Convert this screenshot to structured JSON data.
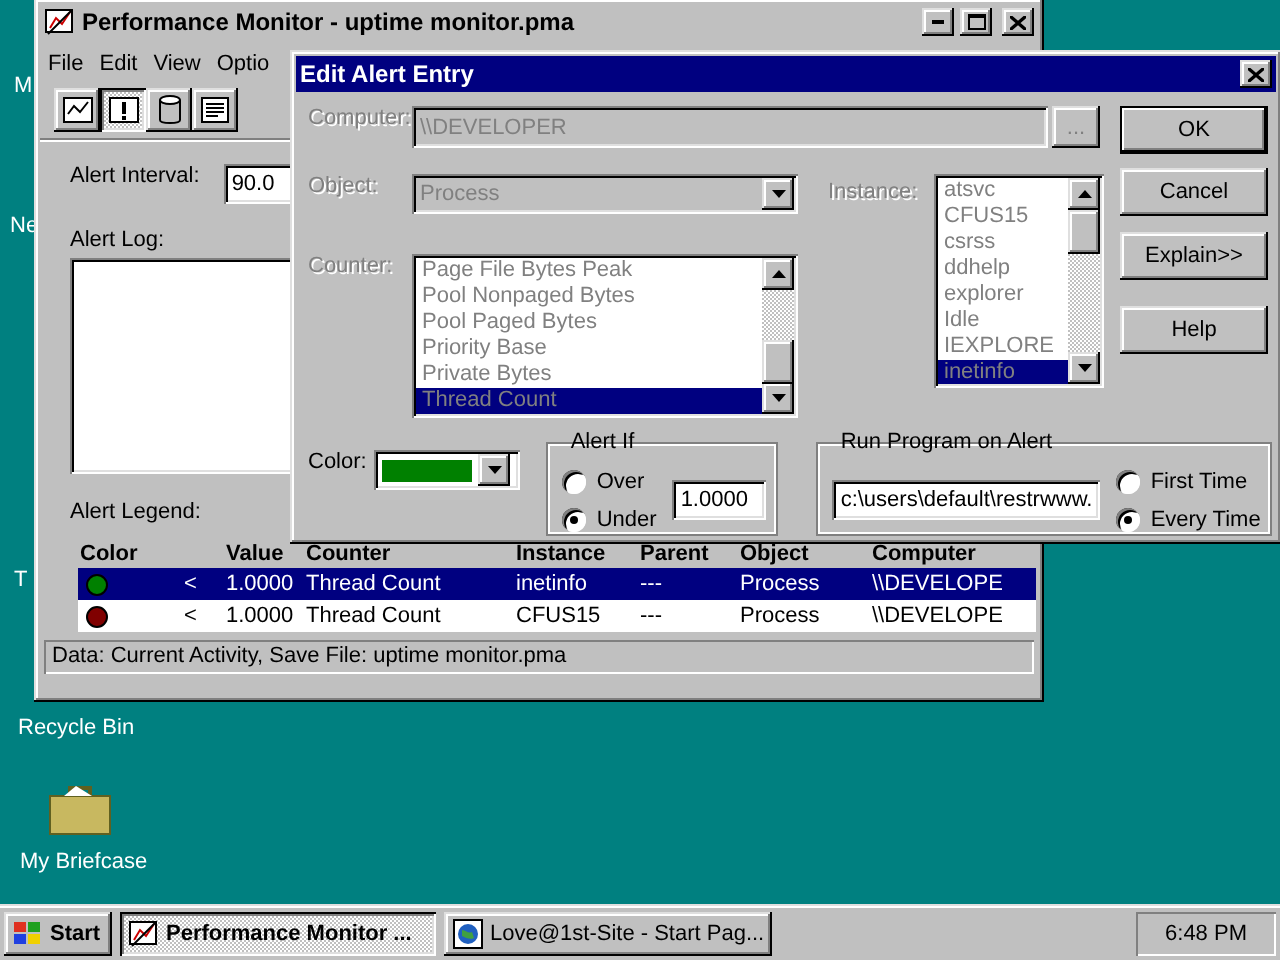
{
  "desktop_icons": [
    {
      "label": "M",
      "kind": "none"
    },
    {
      "label": "Ne",
      "kind": "none"
    },
    {
      "label": "T",
      "kind": "none"
    },
    {
      "label": "Recycle Bin",
      "kind": "none"
    },
    {
      "label": "My Briefcase",
      "kind": "briefcase"
    }
  ],
  "main_window": {
    "title": "Performance Monitor - uptime monitor.pma",
    "menu": [
      "File",
      "Edit",
      "View",
      "Optio"
    ],
    "toolbar": [
      {
        "kind": "chart",
        "selected": false
      },
      {
        "kind": "alert",
        "selected": true
      },
      {
        "kind": "log",
        "selected": false
      },
      {
        "kind": "report",
        "selected": false
      }
    ],
    "alert_interval": {
      "label": "Alert Interval:",
      "value": "90.0"
    },
    "alert_log": {
      "label": "Alert Log:"
    },
    "legend": {
      "label": "Alert Legend:",
      "columns": [
        "Color",
        "Value",
        "Counter",
        "Instance",
        "Parent",
        "Object",
        "Computer"
      ],
      "rows": [
        {
          "color": "#008000",
          "selected": true,
          "condition": "<",
          "value": "1.0000",
          "counter": "Thread Count",
          "instance": "inetinfo",
          "parent": "---",
          "object": "Process",
          "computer": "\\\\DEVELOPE"
        },
        {
          "color": "#800000",
          "selected": false,
          "condition": "<",
          "value": "1.0000",
          "counter": "Thread Count",
          "instance": "CFUS15",
          "parent": "---",
          "object": "Process",
          "computer": "\\\\DEVELOPE"
        }
      ]
    },
    "status_bar": "Data: Current Activity, Save File: uptime monitor.pma"
  },
  "dialog": {
    "title": "Edit Alert Entry",
    "computer": {
      "label": "Computer:",
      "value": "\\\\DEVELOPER",
      "browse": "...",
      "disabled": true
    },
    "object": {
      "label": "Object:",
      "value": "Process",
      "disabled": true
    },
    "counter": {
      "label": "Counter:",
      "disabled": true,
      "items": [
        {
          "text": "Page File Bytes Peak",
          "selected": false
        },
        {
          "text": "Pool Nonpaged Bytes",
          "selected": false
        },
        {
          "text": "Pool Paged Bytes",
          "selected": false
        },
        {
          "text": "Priority Base",
          "selected": false
        },
        {
          "text": "Private Bytes",
          "selected": false
        },
        {
          "text": "Thread Count",
          "selected": true
        }
      ]
    },
    "instance": {
      "label": "Instance:",
      "disabled": true,
      "items": [
        {
          "text": "atsvc",
          "selected": false
        },
        {
          "text": "CFUS15",
          "selected": false
        },
        {
          "text": "csrss",
          "selected": false
        },
        {
          "text": "ddhelp",
          "selected": false
        },
        {
          "text": "explorer",
          "selected": false
        },
        {
          "text": "Idle",
          "selected": false
        },
        {
          "text": "IEXPLORE",
          "selected": false
        },
        {
          "text": "inetinfo",
          "selected": true
        }
      ]
    },
    "buttons": [
      {
        "label": "OK",
        "default": true
      },
      {
        "label": "Cancel",
        "default": false
      },
      {
        "label": "Explain>>",
        "default": false
      },
      {
        "label": "Help",
        "default": false
      }
    ],
    "color": {
      "label": "Color:",
      "color": "#008000"
    },
    "alert_if": {
      "title": "Alert If",
      "options": [
        {
          "label": "Over",
          "selected": false
        },
        {
          "label": "Under",
          "selected": true
        }
      ],
      "value": "1.0000"
    },
    "run_program": {
      "title": "Run Program on Alert",
      "value": "c:\\users\\default\\restrwww.",
      "options": [
        {
          "label": "First Time",
          "selected": false
        },
        {
          "label": "Every Time",
          "selected": true
        }
      ]
    }
  },
  "taskbar": {
    "start": "Start",
    "tasks": [
      {
        "label": "Performance Monitor ...",
        "selected": true,
        "kind": "perfmon"
      },
      {
        "label": "Love@1st-Site - Start Pag...",
        "selected": false,
        "kind": "browser"
      }
    ],
    "clock": "6:48 PM"
  }
}
